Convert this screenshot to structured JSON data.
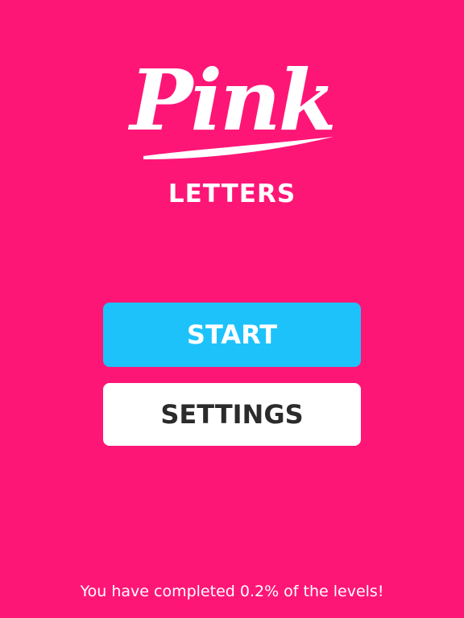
{
  "logo": {
    "word": "Pink"
  },
  "subtitle": "LETTERS",
  "menu": {
    "start_label": "START",
    "settings_label": "SETTINGS"
  },
  "progress_text": "You have completed 0.2% of the levels!",
  "progress_percent": 0.2,
  "colors": {
    "background": "#fe1677",
    "start_button": "#1dc2fb",
    "settings_button": "#ffffff",
    "text_light": "#ffffff",
    "text_dark": "#2b2b2b"
  }
}
